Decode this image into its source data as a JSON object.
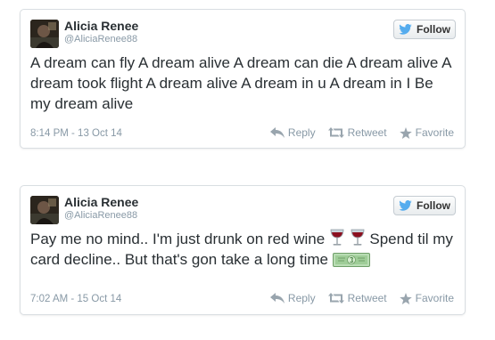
{
  "colors": {
    "twitter_blue": "#55acee",
    "text": "#292f33",
    "muted": "#8899a6"
  },
  "tweets": [
    {
      "user": {
        "name": "Alicia Renee",
        "handle": "@AliciaRenee88",
        "avatar": "profile-photo"
      },
      "follow_label": "Follow",
      "text": "A dream can fly A dream alive A dream can die A dream alive A dream took flight A dream alive A dream in u A dream in I Be my dream alive",
      "timestamp": "8:14 PM - 13 Oct 14",
      "actions": {
        "reply": "Reply",
        "retweet": "Retweet",
        "favorite": "Favorite"
      }
    },
    {
      "user": {
        "name": "Alicia Renee",
        "handle": "@AliciaRenee88",
        "avatar": "profile-photo"
      },
      "follow_label": "Follow",
      "text_part1": "Pay me no mind.. I'm just drunk on red wine",
      "text_part2": " Spend til my card decline.. But that's gon take a long time",
      "emojis": [
        "wine-glass",
        "wine-glass",
        "money-bill"
      ],
      "timestamp": "7:02 AM - 15 Oct 14",
      "actions": {
        "reply": "Reply",
        "retweet": "Retweet",
        "favorite": "Favorite"
      }
    }
  ]
}
